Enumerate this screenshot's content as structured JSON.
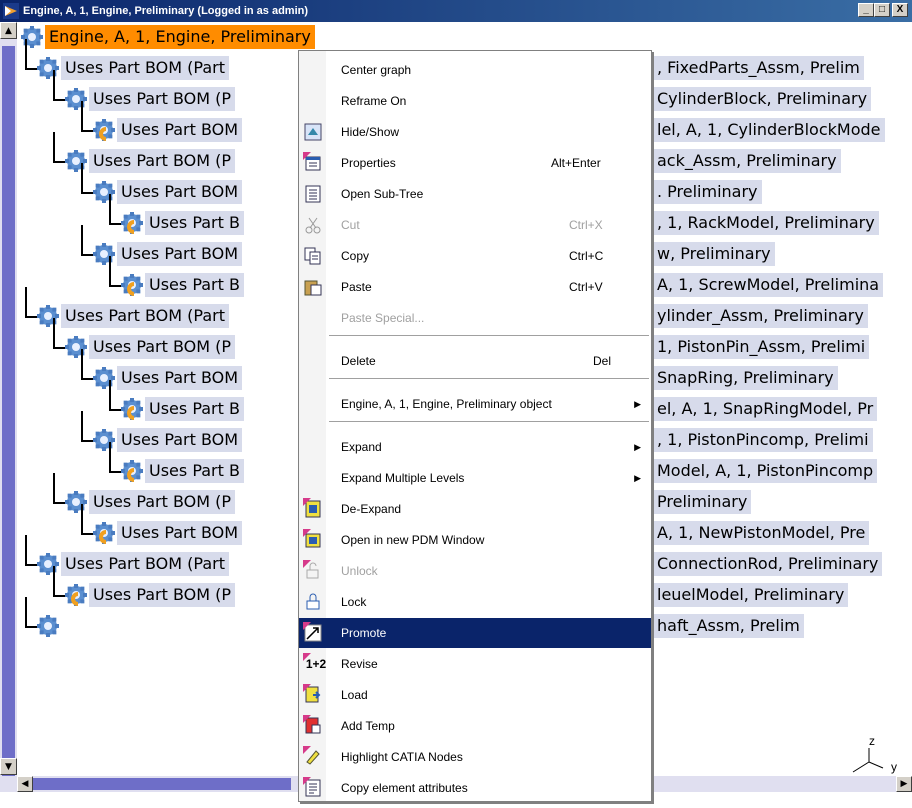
{
  "window": {
    "title": "Engine, A, 1, Engine, Preliminary (Logged in as admin)",
    "buttons": {
      "minimize": "_",
      "maximize": "□",
      "close": "X"
    }
  },
  "tree": {
    "nodes": [
      {
        "text": "Engine, A, 1, Engine, Preliminary",
        "right_text": ""
      },
      {
        "text": "Uses Part BOM (Part",
        "right_text": ", FixedParts_Assm, Prelim"
      },
      {
        "text": "Uses Part BOM (P",
        "right_text": "CylinderBlock, Preliminary"
      },
      {
        "text": "Uses Part BOM",
        "right_text": "lel, A, 1, CylinderBlockMode"
      },
      {
        "text": "Uses Part BOM (P",
        "right_text": "ack_Assm, Preliminary"
      },
      {
        "text": "Uses Part BOM",
        "right_text": ". Preliminary"
      },
      {
        "text": "Uses Part B",
        "right_text": ", 1, RackModel, Preliminary"
      },
      {
        "text": "Uses Part BOM",
        "right_text": "w, Preliminary"
      },
      {
        "text": "Uses Part B",
        "right_text": "A, 1, ScrewModel, Prelimina"
      },
      {
        "text": "Uses Part BOM (Part",
        "right_text": "ylinder_Assm, Preliminary"
      },
      {
        "text": "Uses Part BOM (P",
        "right_text": "1, PistonPin_Assm, Prelimi"
      },
      {
        "text": "Uses Part BOM",
        "right_text": "SnapRing, Preliminary"
      },
      {
        "text": "Uses Part B",
        "right_text": "el, A, 1, SnapRingModel, Pr"
      },
      {
        "text": "Uses Part BOM",
        "right_text": ", 1, PistonPincomp, Prelimi"
      },
      {
        "text": "Uses Part B",
        "right_text": "Model, A, 1, PistonPincomp"
      },
      {
        "text": "Uses Part BOM (P",
        "right_text": "Preliminary"
      },
      {
        "text": "Uses Part BOM",
        "right_text": "A, 1, NewPistonModel, Pre"
      },
      {
        "text": "Uses Part BOM (Part",
        "right_text": "ConnectionRod, Preliminary"
      },
      {
        "text": "Uses Part BOM (P",
        "right_text": "leuelModel, Preliminary"
      },
      {
        "text": "",
        "right_text": "haft_Assm, Prelim"
      }
    ],
    "axis_labels": {
      "z": "z",
      "y": "y"
    }
  },
  "context_menu": {
    "items": [
      {
        "label": "Center graph",
        "shortcut": "",
        "icon": "none",
        "state": "normal"
      },
      {
        "label": "Reframe On",
        "shortcut": "",
        "icon": "none",
        "state": "normal"
      },
      {
        "label": "Hide/Show",
        "shortcut": "",
        "icon": "hide-show-icon",
        "state": "normal"
      },
      {
        "label": "Properties",
        "shortcut": "Alt+Enter",
        "icon": "properties-icon",
        "state": "normal"
      },
      {
        "label": "Open Sub-Tree",
        "shortcut": "",
        "icon": "subtree-icon",
        "state": "normal"
      },
      {
        "label": "Cut",
        "shortcut": "Ctrl+X",
        "icon": "scissors-icon",
        "state": "disabled"
      },
      {
        "label": "Copy",
        "shortcut": "Ctrl+C",
        "icon": "copy-icon",
        "state": "normal"
      },
      {
        "label": "Paste",
        "shortcut": "Ctrl+V",
        "icon": "paste-icon",
        "state": "normal"
      },
      {
        "label": "Paste Special...",
        "shortcut": "",
        "icon": "none",
        "state": "disabled"
      },
      {
        "label": "Delete",
        "shortcut": "Del",
        "icon": "none",
        "state": "normal"
      },
      {
        "label": "Engine, A, 1, Engine, Preliminary object",
        "shortcut": "",
        "icon": "none",
        "state": "submenu"
      },
      {
        "label": "Expand",
        "shortcut": "",
        "icon": "none",
        "state": "submenu"
      },
      {
        "label": "Expand Multiple Levels",
        "shortcut": "",
        "icon": "none",
        "state": "submenu"
      },
      {
        "label": "De-Expand",
        "shortcut": "",
        "icon": "de-expand-icon",
        "state": "normal"
      },
      {
        "label": "Open in new PDM Window",
        "shortcut": "",
        "icon": "pdm-window-icon",
        "state": "normal"
      },
      {
        "label": "Unlock",
        "shortcut": "",
        "icon": "unlock-icon",
        "state": "disabled"
      },
      {
        "label": "Lock",
        "shortcut": "",
        "icon": "lock-icon",
        "state": "normal"
      },
      {
        "label": "Promote",
        "shortcut": "",
        "icon": "promote-icon",
        "state": "selected"
      },
      {
        "label": "Revise",
        "shortcut": "",
        "icon": "revise-icon",
        "state": "normal",
        "icon_text": "1+2"
      },
      {
        "label": "Load",
        "shortcut": "",
        "icon": "load-icon",
        "state": "normal"
      },
      {
        "label": "Add Temp",
        "shortcut": "",
        "icon": "add-temp-icon",
        "state": "normal"
      },
      {
        "label": "Highlight CATIA Nodes",
        "shortcut": "",
        "icon": "highlight-icon",
        "state": "normal"
      },
      {
        "label": "Copy element attributes",
        "shortcut": "",
        "icon": "copy-attributes-icon",
        "state": "normal"
      }
    ]
  },
  "colors": {
    "title_bar": "#0a246a",
    "root_highlight": "#ff8c00",
    "node_background": "#d7dbeb",
    "menu_selected": "#0a246a",
    "scrollbar_thumb": "#6e6ec8"
  }
}
